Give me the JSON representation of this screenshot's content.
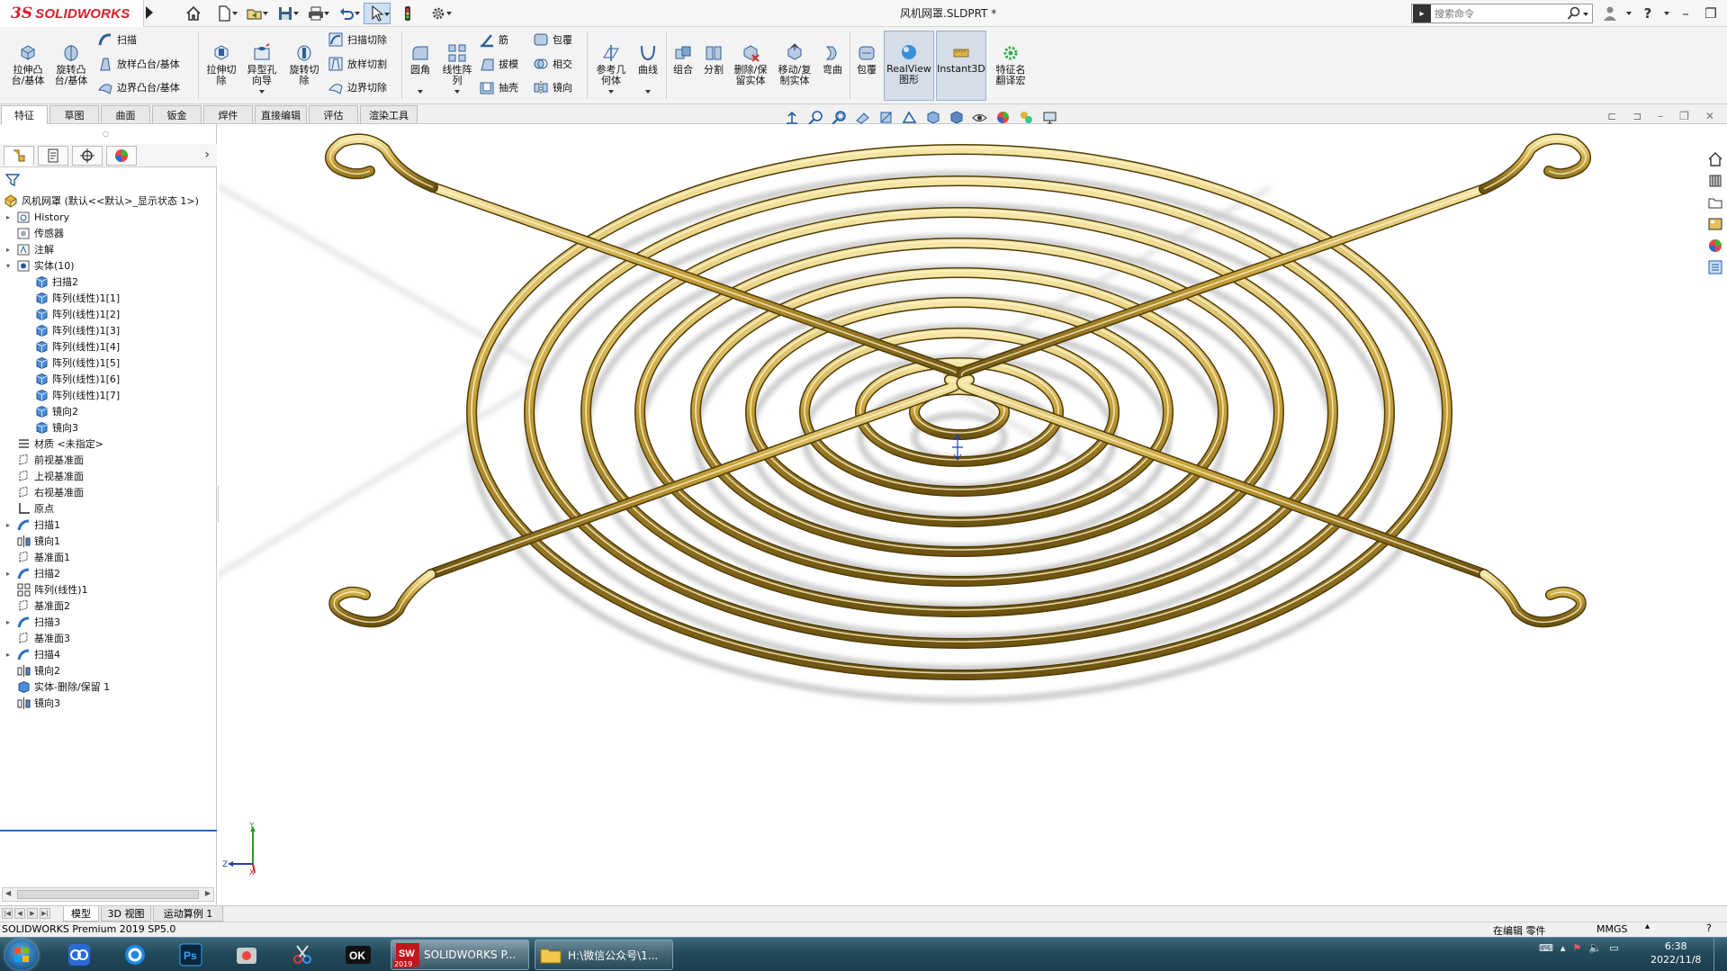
{
  "titlebar": {
    "brand": "SOLIDWORKS",
    "brand_prefix": "3S",
    "document_title": "风机网罩.SLDPRT *",
    "search_placeholder": "搜索命令"
  },
  "ribbon": {
    "extrude_boss": "拉伸凸\n台/基体",
    "revolve_boss": "旋转凸\n台/基体",
    "sweep": "扫描",
    "loft_boss": "放样凸台/基体",
    "boundary_boss": "边界凸台/基体",
    "extrude_cut": "拉伸切\n除",
    "hole_wizard": "异型孔\n向导",
    "revolve_cut": "旋转切\n除",
    "swept_cut": "扫描切除",
    "lofted_cut": "放样切割",
    "boundary_cut": "边界切除",
    "fillet": "圆角",
    "linear_pattern": "线性阵\n列",
    "rib": "筋",
    "draft": "拔模",
    "shell": "抽壳",
    "wrap": "包覆",
    "intersect": "相交",
    "mirror": "镜向",
    "ref_geometry": "参考几\n何体",
    "curves": "曲线",
    "combine": "组合",
    "split": "分割",
    "delete_keep": "删除/保\n留实体",
    "move_copy": "移动/复\n制实体",
    "flex": "弯曲",
    "wrap2": "包覆",
    "realview": "RealView\n图形",
    "instant3d": "Instant3D",
    "feature_translate": "特征名\n翻译宏"
  },
  "tabs": [
    "特征",
    "草图",
    "曲面",
    "钣金",
    "焊件",
    "直接编辑",
    "评估",
    "渲染工具"
  ],
  "tabs_active": "特征",
  "tree": {
    "root": "风机网罩  (默认<<默认>_显示状态 1>)",
    "items": [
      {
        "label": "History",
        "icon": "history-icon",
        "toggle": "▸"
      },
      {
        "label": "传感器",
        "icon": "sensor-icon",
        "toggle": ""
      },
      {
        "label": "注解",
        "icon": "annotation-icon",
        "toggle": "▸"
      },
      {
        "label": "实体(10)",
        "icon": "solid-bodies-icon",
        "toggle": "▾"
      },
      {
        "label": "扫描2",
        "icon": "body-icon",
        "toggle": "",
        "indent": 1
      },
      {
        "label": "阵列(线性)1[1]",
        "icon": "body-icon",
        "toggle": "",
        "indent": 1
      },
      {
        "label": "阵列(线性)1[2]",
        "icon": "body-icon",
        "toggle": "",
        "indent": 1
      },
      {
        "label": "阵列(线性)1[3]",
        "icon": "body-icon",
        "toggle": "",
        "indent": 1
      },
      {
        "label": "阵列(线性)1[4]",
        "icon": "body-icon",
        "toggle": "",
        "indent": 1
      },
      {
        "label": "阵列(线性)1[5]",
        "icon": "body-icon",
        "toggle": "",
        "indent": 1
      },
      {
        "label": "阵列(线性)1[6]",
        "icon": "body-icon",
        "toggle": "",
        "indent": 1
      },
      {
        "label": "阵列(线性)1[7]",
        "icon": "body-icon",
        "toggle": "",
        "indent": 1
      },
      {
        "label": "镜向2",
        "icon": "body-icon",
        "toggle": "",
        "indent": 1
      },
      {
        "label": "镜向3",
        "icon": "body-icon",
        "toggle": "",
        "indent": 1
      },
      {
        "label": "材质 <未指定>",
        "icon": "material-icon",
        "toggle": ""
      },
      {
        "label": "前视基准面",
        "icon": "plane-icon",
        "toggle": ""
      },
      {
        "label": "上视基准面",
        "icon": "plane-icon",
        "toggle": ""
      },
      {
        "label": "右视基准面",
        "icon": "plane-icon",
        "toggle": ""
      },
      {
        "label": "原点",
        "icon": "origin-icon",
        "toggle": ""
      },
      {
        "label": "扫描1",
        "icon": "sweep-icon",
        "toggle": "▸"
      },
      {
        "label": "镜向1",
        "icon": "mirror-icon",
        "toggle": ""
      },
      {
        "label": "基准面1",
        "icon": "plane-icon",
        "toggle": ""
      },
      {
        "label": "扫描2",
        "icon": "sweep-icon",
        "toggle": "▸"
      },
      {
        "label": "阵列(线性)1",
        "icon": "pattern-icon",
        "toggle": ""
      },
      {
        "label": "基准面2",
        "icon": "plane-icon",
        "toggle": ""
      },
      {
        "label": "扫描3",
        "icon": "sweep-icon",
        "toggle": "▸"
      },
      {
        "label": "基准面3",
        "icon": "plane-icon",
        "toggle": ""
      },
      {
        "label": "扫描4",
        "icon": "sweep-icon",
        "toggle": "▸"
      },
      {
        "label": "镜向2",
        "icon": "mirror-icon",
        "toggle": ""
      },
      {
        "label": "实体-删除/保留 1",
        "icon": "delete-body-icon",
        "toggle": ""
      },
      {
        "label": "镜向3",
        "icon": "mirror-icon",
        "toggle": ""
      }
    ]
  },
  "bottom_tabs": [
    "模型",
    "3D 视图",
    "运动算例 1"
  ],
  "bottom_tabs_active": "模型",
  "status": {
    "app": "SOLIDWORKS Premium 2019 SP5.0",
    "editing": "在编辑 零件",
    "units": "MMGS",
    "help": "?"
  },
  "triad": {
    "x": "X",
    "y": "Y",
    "z": "Z"
  },
  "taskbar": {
    "sw_task": "SOLIDWORKS P...",
    "sw_badge": "2019",
    "folder_task": "H:\\微信公众号\\1...",
    "time": "6:38",
    "date": "2022/11/8"
  },
  "colors": {
    "brand_red": "#d4202a",
    "gold": "#c9a33a",
    "selection_blue": "#1e6fb8"
  }
}
